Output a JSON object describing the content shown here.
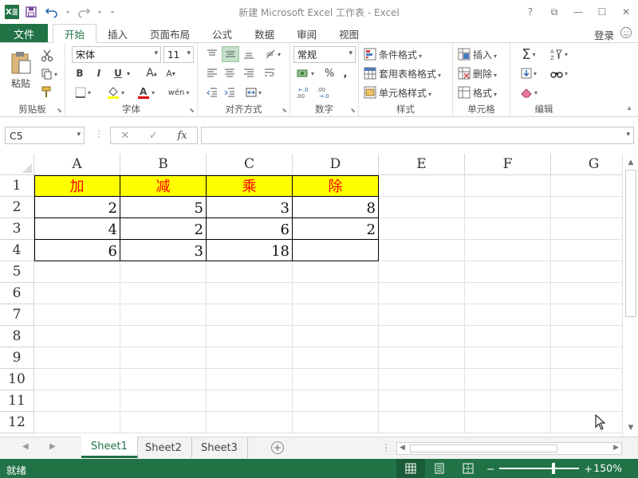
{
  "titlebar": {
    "logo": "X≣",
    "title": "新建 Microsoft Excel 工作表 - Excel",
    "help": "?",
    "ribbon_display": "⧉",
    "minimize": "—",
    "maximize": "☐",
    "close": "✕"
  },
  "tabs": {
    "file": "文件",
    "items": [
      "开始",
      "插入",
      "页面布局",
      "公式",
      "数据",
      "审阅",
      "视图"
    ],
    "login": "登录"
  },
  "ribbon": {
    "clipboard": {
      "label": "剪贴板",
      "paste": "粘贴"
    },
    "font": {
      "label": "字体",
      "name": "宋体",
      "size": "11",
      "bold": "B",
      "italic": "I",
      "underline": "U",
      "grow": "A",
      "shrink": "A",
      "phonetic": "wén"
    },
    "alignment": {
      "label": "对齐方式"
    },
    "number": {
      "label": "数字",
      "format": "常规",
      "percent": "%",
      "comma": ",",
      "inc_decimal": "←.0\n.00",
      "dec_decimal": ".00\n→.0"
    },
    "styles": {
      "label": "样式",
      "conditional": "条件格式",
      "table": "套用表格格式",
      "cell": "单元格样式"
    },
    "cells": {
      "label": "单元格",
      "insert": "插入",
      "delete": "删除",
      "format": "格式"
    },
    "editing": {
      "label": "编辑"
    }
  },
  "formula_bar": {
    "name_box": "C5",
    "formula": "",
    "fx": "fx"
  },
  "grid": {
    "columns": [
      "A",
      "B",
      "C",
      "D",
      "E",
      "F",
      "G"
    ],
    "rows": [
      "1",
      "2",
      "3",
      "4",
      "5",
      "6",
      "7",
      "8",
      "9",
      "10",
      "11",
      "12"
    ],
    "header_row": [
      "加",
      "减",
      "乘",
      "除"
    ],
    "data": [
      [
        "2",
        "5",
        "3",
        "8"
      ],
      [
        "4",
        "2",
        "6",
        "2"
      ],
      [
        "6",
        "3",
        "18",
        ""
      ]
    ]
  },
  "sheets": {
    "tabs": [
      "Sheet1",
      "Sheet2",
      "Sheet3"
    ],
    "active": "Sheet1",
    "add": "+"
  },
  "status": {
    "ready": "就绪",
    "zoom": "150%",
    "zoom_minus": "−",
    "zoom_plus": "+"
  },
  "colors": {
    "accent": "#217346",
    "header_fill": "#FFFF00",
    "header_text": "#FF0000"
  }
}
